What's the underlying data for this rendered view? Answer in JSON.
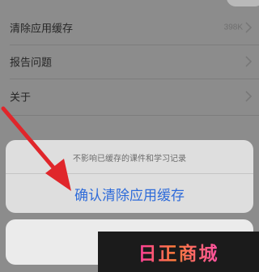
{
  "settings": {
    "items": [
      {
        "label": "清除应用缓存",
        "value": "398K"
      },
      {
        "label": "报告问题",
        "value": ""
      },
      {
        "label": "关于",
        "value": ""
      }
    ]
  },
  "action_sheet": {
    "message": "不影响已缓存的课件和学习记录",
    "confirm_label": "确认清除应用缓存"
  },
  "watermark": {
    "text": "日正商城"
  },
  "colors": {
    "confirm": "#2e6bd9",
    "arrow": "#e0262b",
    "overlay": "#8b8b8b"
  }
}
